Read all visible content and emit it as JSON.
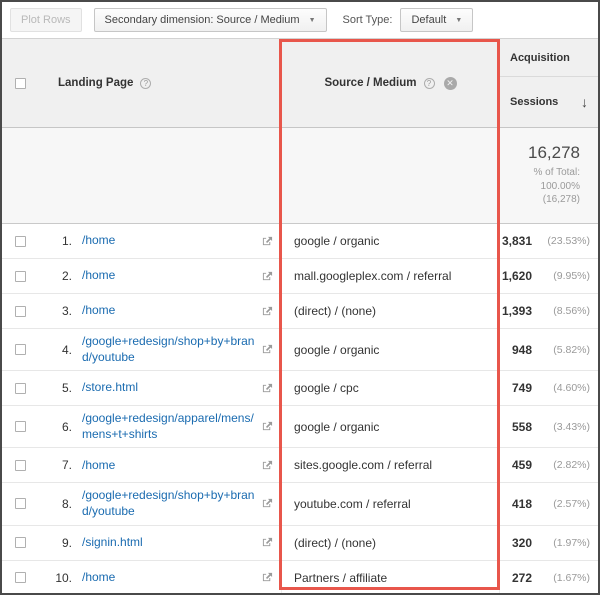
{
  "toolbar": {
    "plot_rows": "Plot Rows",
    "secondary_dimension": "Secondary dimension: Source / Medium",
    "sort_type_label": "Sort Type:",
    "sort_type_value": "Default"
  },
  "icons": {
    "caret": "▼",
    "sort_down": "↓",
    "help": "?",
    "remove": "✕"
  },
  "header": {
    "landing_page": "Landing Page",
    "source_medium": "Source / Medium",
    "acquisition": "Acquisition",
    "sessions": "Sessions"
  },
  "totals": {
    "sessions": "16,278",
    "pct_label": "% of Total:",
    "pct_value": "100.00%",
    "pct_total": "(16,278)"
  },
  "rows": [
    {
      "num": "1.",
      "landing_page": "/home",
      "source_medium": "google / organic",
      "sessions": "3,831",
      "pct": "(23.53%)"
    },
    {
      "num": "2.",
      "landing_page": "/home",
      "source_medium": "mall.googleplex.com / referral",
      "sessions": "1,620",
      "pct": "(9.95%)"
    },
    {
      "num": "3.",
      "landing_page": "/home",
      "source_medium": "(direct) / (none)",
      "sessions": "1,393",
      "pct": "(8.56%)"
    },
    {
      "num": "4.",
      "landing_page": "/google+redesign/shop+by+brand/youtube",
      "source_medium": "google / organic",
      "sessions": "948",
      "pct": "(5.82%)"
    },
    {
      "num": "5.",
      "landing_page": "/store.html",
      "source_medium": "google / cpc",
      "sessions": "749",
      "pct": "(4.60%)"
    },
    {
      "num": "6.",
      "landing_page": "/google+redesign/apparel/mens/mens+t+shirts",
      "source_medium": "google / organic",
      "sessions": "558",
      "pct": "(3.43%)"
    },
    {
      "num": "7.",
      "landing_page": "/home",
      "source_medium": "sites.google.com / referral",
      "sessions": "459",
      "pct": "(2.82%)"
    },
    {
      "num": "8.",
      "landing_page": "/google+redesign/shop+by+brand/youtube",
      "source_medium": "youtube.com / referral",
      "sessions": "418",
      "pct": "(2.57%)"
    },
    {
      "num": "9.",
      "landing_page": "/signin.html",
      "source_medium": "(direct) / (none)",
      "sessions": "320",
      "pct": "(1.97%)"
    },
    {
      "num": "10.",
      "landing_page": "/home",
      "source_medium": "Partners / affiliate",
      "sessions": "272",
      "pct": "(1.67%)"
    }
  ],
  "colors": {
    "link": "#1a6bb0",
    "highlight": "#e8564b"
  }
}
